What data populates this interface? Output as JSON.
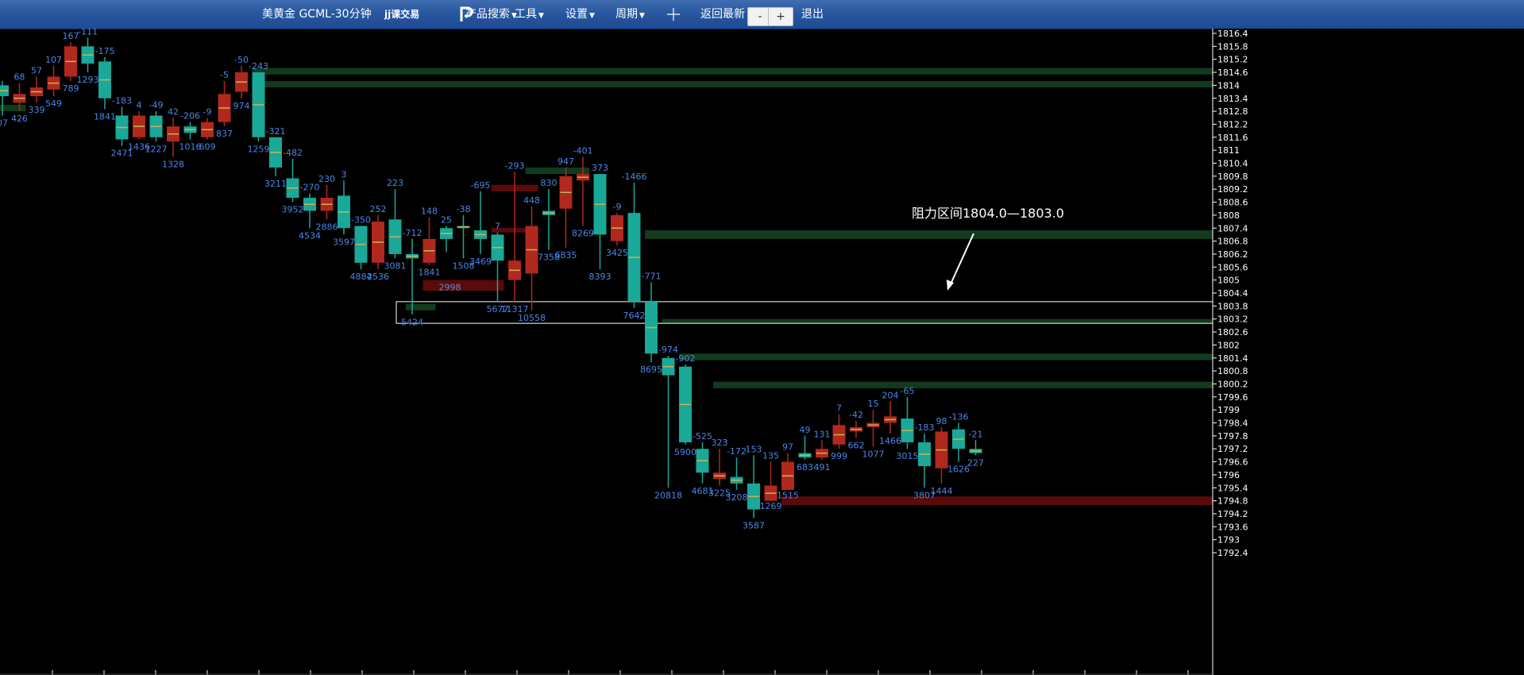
{
  "toolbar": {
    "title": "美黄金 GCML-30分钟",
    "logo_text": "jj课交易",
    "menus": [
      "产品搜索",
      "工具",
      "设置",
      "周期"
    ],
    "crosshair_icon": "crosshair-icon",
    "return_latest": "返回最新",
    "zoom_out": "-",
    "zoom_in": "+",
    "exit": "退出"
  },
  "colors": {
    "background": "#000000",
    "up": "#1aa898",
    "down": "#b0281e",
    "volume_label": "#4a86e8",
    "zone_green": "#123a1c",
    "zone_red": "#5a0a0a"
  },
  "annotation": "阻力区间1804.0—1803.0",
  "chart_data": {
    "type": "candlestick",
    "y_axis_ticks": [
      "1816.4",
      "1815.8",
      "1815.2",
      "1814.6",
      "1814",
      "1813.4",
      "1812.8",
      "1812.2",
      "1811.6",
      "1811",
      "1810.4",
      "1809.8",
      "1809.2",
      "1808.6",
      "1808",
      "1807.4",
      "1806.8",
      "1806.2",
      "1805.6",
      "1805",
      "1804.4",
      "1803.8",
      "1803.2",
      "1802.6",
      "1802",
      "1801.4",
      "1800.8",
      "1800.2",
      "1799.6",
      "1799",
      "1798.4",
      "1797.8",
      "1797.2",
      "1796.6",
      "1796",
      "1795.4",
      "1794.8",
      "1794.2",
      "1793.6",
      "1793",
      "1792.4"
    ],
    "ylim": [
      1792.4,
      1816.4
    ],
    "candles": [
      {
        "o": 1813.5,
        "h": 1814.2,
        "l": 1812.6,
        "c": 1814.0,
        "top": "",
        "bot": "07"
      },
      {
        "o": 1813.6,
        "h": 1814.1,
        "l": 1812.8,
        "c": 1813.2,
        "top": "68",
        "bot": "426"
      },
      {
        "o": 1813.9,
        "h": 1814.4,
        "l": 1813.2,
        "c": 1813.5,
        "top": "57",
        "bot": "339"
      },
      {
        "o": 1814.4,
        "h": 1814.9,
        "l": 1813.5,
        "c": 1813.8,
        "top": "107",
        "bot": "549"
      },
      {
        "o": 1815.8,
        "h": 1816.0,
        "l": 1814.2,
        "c": 1814.4,
        "top": "167",
        "bot": "789"
      },
      {
        "o": 1815.0,
        "h": 1816.2,
        "l": 1814.6,
        "c": 1815.8,
        "top": "-111",
        "bot": "1293"
      },
      {
        "o": 1813.4,
        "h": 1815.3,
        "l": 1812.9,
        "c": 1815.1,
        "top": "-175",
        "bot": "1841"
      },
      {
        "o": 1811.5,
        "h": 1813.0,
        "l": 1811.2,
        "c": 1812.6,
        "top": "-183",
        "bot": "2471"
      },
      {
        "o": 1812.6,
        "h": 1812.8,
        "l": 1811.5,
        "c": 1811.6,
        "top": "4",
        "bot": "1436"
      },
      {
        "o": 1811.6,
        "h": 1812.8,
        "l": 1811.4,
        "c": 1812.6,
        "top": "-49",
        "bot": "1227"
      },
      {
        "o": 1812.1,
        "h": 1812.5,
        "l": 1810.7,
        "c": 1811.4,
        "top": "42",
        "bot": "1328"
      },
      {
        "o": 1811.8,
        "h": 1812.3,
        "l": 1811.5,
        "c": 1812.1,
        "top": "-206",
        "bot": "1016"
      },
      {
        "o": 1812.3,
        "h": 1812.5,
        "l": 1811.5,
        "c": 1811.6,
        "top": "-9",
        "bot": "609"
      },
      {
        "o": 1813.6,
        "h": 1814.2,
        "l": 1812.1,
        "c": 1812.3,
        "top": "-5",
        "bot": "837"
      },
      {
        "o": 1814.6,
        "h": 1814.9,
        "l": 1813.4,
        "c": 1813.7,
        "top": "-50",
        "bot": "974"
      },
      {
        "o": 1811.6,
        "h": 1814.6,
        "l": 1811.4,
        "c": 1814.6,
        "top": "-243",
        "bot": "1259"
      },
      {
        "o": 1810.2,
        "h": 1811.6,
        "l": 1809.8,
        "c": 1811.6,
        "top": "-321",
        "bot": "3211"
      },
      {
        "o": 1808.8,
        "h": 1810.6,
        "l": 1808.6,
        "c": 1809.7,
        "top": "-482",
        "bot": "3952"
      },
      {
        "o": 1808.2,
        "h": 1809.0,
        "l": 1807.4,
        "c": 1808.8,
        "top": "-270",
        "bot": "4534"
      },
      {
        "o": 1808.8,
        "h": 1809.4,
        "l": 1807.8,
        "c": 1808.2,
        "top": "230",
        "bot": "2886"
      },
      {
        "o": 1807.4,
        "h": 1809.6,
        "l": 1807.1,
        "c": 1808.9,
        "top": "3",
        "bot": "3597"
      },
      {
        "o": 1805.8,
        "h": 1807.5,
        "l": 1805.5,
        "c": 1807.5,
        "top": "-350",
        "bot": "4884"
      },
      {
        "o": 1807.7,
        "h": 1808.0,
        "l": 1805.5,
        "c": 1805.8,
        "top": "252",
        "bot": "2536"
      },
      {
        "o": 1806.2,
        "h": 1809.2,
        "l": 1806.0,
        "c": 1807.8,
        "top": "223",
        "bot": "3081"
      },
      {
        "o": 1806.0,
        "h": 1806.9,
        "l": 1803.4,
        "c": 1806.2,
        "top": "-712",
        "bot": "5424"
      },
      {
        "o": 1806.9,
        "h": 1807.9,
        "l": 1805.7,
        "c": 1805.8,
        "top": "148",
        "bot": "1841"
      },
      {
        "o": 1806.9,
        "h": 1807.5,
        "l": 1806.3,
        "c": 1807.4,
        "top": "25",
        "bot": ""
      },
      {
        "o": 1807.4,
        "h": 1808.0,
        "l": 1806.0,
        "c": 1807.5,
        "top": "-38",
        "bot": "1508"
      },
      {
        "o": 1806.9,
        "h": 1809.1,
        "l": 1806.2,
        "c": 1807.3,
        "top": "-695",
        "bot": "3469"
      },
      {
        "o": 1805.9,
        "h": 1807.2,
        "l": 1804.0,
        "c": 1807.1,
        "top": "7",
        "bot": "5677"
      },
      {
        "o": 1805.9,
        "h": 1810.0,
        "l": 1804.0,
        "c": 1805.0,
        "top": "-293",
        "bot": "11317"
      },
      {
        "o": 1807.5,
        "h": 1808.4,
        "l": 1803.6,
        "c": 1805.3,
        "top": "448",
        "bot": "10558"
      },
      {
        "o": 1808.0,
        "h": 1809.2,
        "l": 1806.4,
        "c": 1808.2,
        "top": "830",
        "bot": "7358"
      },
      {
        "o": 1809.8,
        "h": 1810.2,
        "l": 1806.5,
        "c": 1808.3,
        "top": "947",
        "bot": "6835"
      },
      {
        "o": 1809.9,
        "h": 1810.7,
        "l": 1807.5,
        "c": 1809.6,
        "top": "-401",
        "bot": "8269"
      },
      {
        "o": 1807.1,
        "h": 1809.9,
        "l": 1805.5,
        "c": 1809.9,
        "top": "373",
        "bot": "8393"
      },
      {
        "o": 1808.0,
        "h": 1808.1,
        "l": 1806.6,
        "c": 1806.8,
        "top": "-9",
        "bot": "3425"
      },
      {
        "o": 1804.0,
        "h": 1809.5,
        "l": 1803.7,
        "c": 1808.1,
        "top": "-1466",
        "bot": "7642"
      },
      {
        "o": 1801.6,
        "h": 1804.9,
        "l": 1801.2,
        "c": 1804.0,
        "top": "-771",
        "bot": "8695"
      },
      {
        "o": 1800.6,
        "h": 1801.5,
        "l": 1795.4,
        "c": 1801.4,
        "top": "-974",
        "bot": "20818"
      },
      {
        "o": 1797.5,
        "h": 1801.1,
        "l": 1797.4,
        "c": 1801.0,
        "top": "-902",
        "bot": "5900"
      },
      {
        "o": 1796.1,
        "h": 1797.5,
        "l": 1795.6,
        "c": 1797.2,
        "top": "-525",
        "bot": "4681"
      },
      {
        "o": 1796.1,
        "h": 1797.2,
        "l": 1795.5,
        "c": 1795.8,
        "top": "323",
        "bot": "3225"
      },
      {
        "o": 1795.6,
        "h": 1796.8,
        "l": 1795.3,
        "c": 1795.9,
        "top": "-172",
        "bot": "3208"
      },
      {
        "o": 1794.4,
        "h": 1796.9,
        "l": 1794.0,
        "c": 1795.6,
        "top": "153",
        "bot": "3587"
      },
      {
        "o": 1795.5,
        "h": 1796.6,
        "l": 1794.9,
        "c": 1794.8,
        "top": "135",
        "bot": "1269"
      },
      {
        "o": 1796.6,
        "h": 1797.0,
        "l": 1795.4,
        "c": 1795.3,
        "top": "97",
        "bot": "1515"
      },
      {
        "o": 1796.8,
        "h": 1797.8,
        "l": 1796.7,
        "c": 1797.0,
        "top": "49",
        "bot": "683"
      },
      {
        "o": 1797.2,
        "h": 1797.6,
        "l": 1796.7,
        "c": 1796.8,
        "top": "131",
        "bot": "491"
      },
      {
        "o": 1798.3,
        "h": 1798.8,
        "l": 1797.2,
        "c": 1797.4,
        "top": "7",
        "bot": "999"
      },
      {
        "o": 1798.2,
        "h": 1798.5,
        "l": 1797.7,
        "c": 1798.0,
        "top": "-42",
        "bot": "662"
      },
      {
        "o": 1798.4,
        "h": 1799.0,
        "l": 1797.3,
        "c": 1798.2,
        "top": "15",
        "bot": "1077"
      },
      {
        "o": 1798.7,
        "h": 1799.4,
        "l": 1797.9,
        "c": 1798.4,
        "top": "204",
        "bot": "1466"
      },
      {
        "o": 1797.5,
        "h": 1799.6,
        "l": 1797.2,
        "c": 1798.6,
        "top": "-65",
        "bot": "3015"
      },
      {
        "o": 1796.4,
        "h": 1797.9,
        "l": 1795.4,
        "c": 1797.5,
        "top": "-183",
        "bot": "3807"
      },
      {
        "o": 1798.0,
        "h": 1798.2,
        "l": 1795.6,
        "c": 1796.3,
        "top": "98",
        "bot": "1444"
      },
      {
        "o": 1797.2,
        "h": 1798.4,
        "l": 1796.6,
        "c": 1798.1,
        "top": "-136",
        "bot": "1626"
      },
      {
        "o": 1797.0,
        "h": 1797.6,
        "l": 1796.9,
        "c": 1797.2,
        "top": "-21",
        "bot": "227"
      }
    ],
    "zones": [
      {
        "color": "green",
        "from_candle": 15,
        "y0": 1814.5,
        "y1": 1814.8
      },
      {
        "color": "green",
        "from_candle": 15,
        "y0": 1813.9,
        "y1": 1814.2
      },
      {
        "color": "green",
        "from_candle": 38,
        "y0": 1806.9,
        "y1": 1807.3
      },
      {
        "color": "green",
        "from_candle": 39,
        "y0": 1803.0,
        "y1": 1803.2
      },
      {
        "color": "green",
        "from_candle": 40,
        "y0": 1801.3,
        "y1": 1801.6
      },
      {
        "color": "green",
        "from_candle": 42,
        "y0": 1800.0,
        "y1": 1800.3
      },
      {
        "color": "red",
        "from_candle": 46,
        "y0": 1794.6,
        "y1": 1795.0
      },
      {
        "color": "green",
        "from_candle": 0,
        "to_candle": 1,
        "y0": 1812.8,
        "y1": 1813.1
      },
      {
        "color": "green",
        "from_candle": 31,
        "to_candle": 34,
        "y0": 1809.9,
        "y1": 1810.2
      },
      {
        "color": "red",
        "from_candle": 29,
        "to_candle": 31,
        "y0": 1809.1,
        "y1": 1809.4
      },
      {
        "color": "red",
        "from_candle": 29,
        "to_candle": 31,
        "y0": 1807.2,
        "y1": 1807.4
      },
      {
        "color": "red",
        "from_candle": 25,
        "to_candle": 29,
        "y0": 1804.5,
        "y1": 1805.0,
        "label": "2998"
      },
      {
        "color": "green",
        "from_candle": 24,
        "to_candle": 25,
        "y0": 1803.6,
        "y1": 1803.9
      }
    ],
    "resistance_box": {
      "y0": 1803.0,
      "y1": 1804.0,
      "from_candle": 24
    }
  }
}
